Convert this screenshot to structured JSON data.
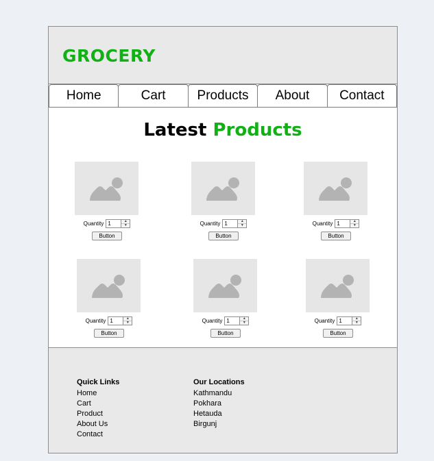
{
  "header": {
    "logo": "GROCERY"
  },
  "nav": {
    "items": [
      "Home",
      "Cart",
      "Products",
      "About",
      "Contact"
    ]
  },
  "title": {
    "main": "Latest ",
    "accent": "Products"
  },
  "products": {
    "quantity_label": "Quantity",
    "quantity_value": "1",
    "button_label": "Button",
    "image_icon": "image-placeholder-icon"
  },
  "footer": {
    "quick_links": {
      "heading": "Quick Links",
      "items": [
        "Home",
        "Cart",
        "Product",
        "About Us",
        "Contact"
      ]
    },
    "locations": {
      "heading": "Our Locations",
      "items": [
        "Kathmandu",
        "Pokhara",
        "Hetauda",
        "Birgunj"
      ]
    }
  },
  "colors": {
    "accent": "#11b014",
    "panel": "#e9e9e9",
    "placeholder": "#e6e6e6",
    "placeholder_glyph": "#b3b3b3"
  }
}
